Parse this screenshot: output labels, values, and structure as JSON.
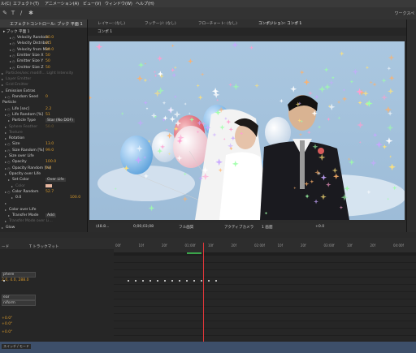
{
  "menubar": {
    "items": [
      "ル(C)",
      "エフェクト(T)",
      "アニメーション(A)",
      "ビュー(V)",
      "ウィンドウ(W)",
      "ヘルプ(H)"
    ]
  },
  "toolbar": {
    "workspace_label": "ワークスペ"
  },
  "effect_panel": {
    "header_title": "エフェクトコントロール: ブック 平面 1",
    "layer_name": "▸ ブック 平面 1",
    "properties": [
      {
        "label": "Velocity Random",
        "value": "20.0",
        "indent": 16,
        "watch": true,
        "dim": false
      },
      {
        "label": "Velocity Distribut",
        "value": "0.5",
        "indent": 16,
        "watch": true,
        "dim": false
      },
      {
        "label": "Velocity from Mot",
        "value": "20.0",
        "indent": 16,
        "watch": true,
        "dim": false
      },
      {
        "label": "Emitter Size X",
        "value": "50",
        "indent": 16,
        "watch": true,
        "dim": false
      },
      {
        "label": "Emitter Size Y",
        "value": "50",
        "indent": 16,
        "watch": true,
        "dim": false
      },
      {
        "label": "Emitter Size Z",
        "value": "50",
        "indent": 16,
        "watch": true,
        "dim": false
      },
      {
        "label": "Particles/sec modifi... Light Intensity",
        "value": "",
        "indent": 6,
        "watch": false,
        "dim": true
      },
      {
        "label": "Layer Emitter",
        "value": "",
        "indent": 6,
        "watch": false,
        "dim": true
      },
      {
        "label": "Grid Emitter",
        "value": "",
        "indent": 6,
        "watch": false,
        "dim": true
      },
      {
        "label": "Emission Extras",
        "value": "",
        "indent": 6,
        "watch": false,
        "dim": false
      },
      {
        "label": "Random Seed",
        "value": "0",
        "indent": 10,
        "watch": true,
        "dim": false
      },
      {
        "label": "Particle",
        "value": "",
        "indent": 2,
        "watch": false,
        "dim": false
      },
      {
        "label": "Life [sec]",
        "value": "2.2",
        "indent": 10,
        "watch": true,
        "dim": false
      },
      {
        "label": "Life Random [%]",
        "value": "51",
        "indent": 10,
        "watch": true,
        "dim": false
      },
      {
        "label": "Particle Type",
        "value": "Star (No DOF)",
        "indent": 14,
        "watch": false,
        "dim": false
      },
      {
        "label": "Sphere Feather",
        "value": "50.0",
        "indent": 10,
        "watch": false,
        "dim": true
      },
      {
        "label": "Texture",
        "value": "",
        "indent": 10,
        "watch": false,
        "dim": true
      },
      {
        "label": "Rotation",
        "value": "",
        "indent": 10,
        "watch": false,
        "dim": false
      },
      {
        "label": "Size",
        "value": "13.0",
        "indent": 10,
        "watch": true,
        "dim": false
      },
      {
        "label": "Size Random [%]",
        "value": "99.0",
        "indent": 10,
        "watch": true,
        "dim": false
      },
      {
        "label": "Size over Life",
        "value": "",
        "indent": 10,
        "watch": false,
        "dim": false
      },
      {
        "label": "Opacity",
        "value": "100.0",
        "indent": 10,
        "watch": true,
        "dim": false
      },
      {
        "label": "Opacity Random [%]",
        "value": "0.0",
        "indent": 10,
        "watch": true,
        "dim": false
      },
      {
        "label": "Opacity over Life",
        "value": "",
        "indent": 10,
        "watch": false,
        "dim": false
      },
      {
        "label": "Set Color",
        "value": "Over Life",
        "indent": 14,
        "watch": false,
        "dim": false
      },
      {
        "label": "Color",
        "value": "",
        "indent": 18,
        "watch": false,
        "dim": true
      },
      {
        "label": "Color Random",
        "value": "52.7",
        "indent": 10,
        "watch": true,
        "dim": false
      },
      {
        "label": "0.0",
        "value": "100.0",
        "indent": 18,
        "watch": false,
        "dim": false
      },
      {
        "label": "",
        "value": "",
        "indent": 10,
        "watch": false,
        "dim": false
      },
      {
        "label": "Color over Life",
        "value": "",
        "indent": 10,
        "watch": false,
        "dim": false
      },
      {
        "label": "Transfer Mode",
        "value": "Add",
        "indent": 14,
        "watch": false,
        "dim": false
      },
      {
        "label": "Transfer Mode over Li...",
        "value": "",
        "indent": 10,
        "watch": false,
        "dim": true
      },
      {
        "label": "Glow",
        "value": "",
        "indent": 6,
        "watch": false,
        "dim": false
      }
    ],
    "color_swatch": "#e8b7a0"
  },
  "viewer": {
    "tabs": [
      {
        "label": "レイヤー: (なし)",
        "active": false
      },
      {
        "label": "フッテージ: (なし)",
        "active": false
      },
      {
        "label": "フローチャート: (なし)",
        "active": false
      },
      {
        "label": "コンポジション: コンポ 1",
        "active": true
      }
    ],
    "comp_label": "コンポ 1",
    "controls": [
      "(48.8...",
      "0;00;03;08",
      "フル画質",
      "アクティブカメラ",
      "1 画面",
      "+0.0"
    ]
  },
  "timeline": {
    "layer_col_label": "ード",
    "trk_label": "T トラックマット",
    "ruler_ticks": [
      "00f",
      "10f",
      "20f",
      "01:00f",
      "10f",
      "20f",
      "02:00f",
      "10f",
      "20f",
      "03:00f",
      "10f",
      "20f",
      "04:00f"
    ],
    "rows": [
      {
        "type": "dropdown",
        "text": "phere"
      },
      {
        "type": "value",
        "text": "2.0, 4.0, 288.0"
      },
      {
        "type": "dropdown",
        "text": "ear"
      },
      {
        "type": "dropdown",
        "text": "niform"
      },
      {
        "type": "value",
        "text": "+0.0°"
      },
      {
        "type": "value",
        "text": "+0.0°"
      },
      {
        "type": "value",
        "text": "+0.0°"
      }
    ],
    "bottom_label": "スイッチ / モード"
  },
  "colors": {
    "accent_value": "#d99a2b",
    "playhead": "#e0373a",
    "keyframe_bar": "#3aa34a"
  }
}
